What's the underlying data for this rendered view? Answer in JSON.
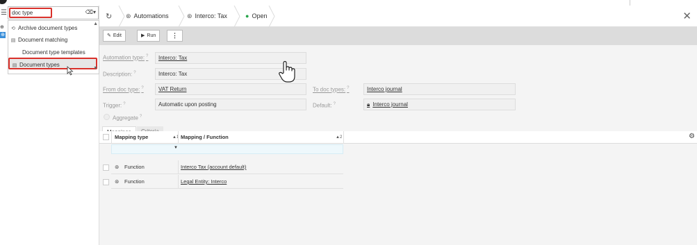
{
  "search": {
    "value": "doc type"
  },
  "dropdown": {
    "items": [
      {
        "label": "Archive document types",
        "icon": "history-icon"
      },
      {
        "label": "Document matching",
        "icon": "document-icon"
      },
      {
        "label": "Document type templates",
        "icon": ""
      },
      {
        "label": "Document types",
        "icon": "document-icon",
        "selected": true
      }
    ]
  },
  "breadcrumbs": [
    {
      "label": "Automations",
      "icon": "automation-icon"
    },
    {
      "label": "Interco: Tax",
      "icon": "automation-icon"
    },
    {
      "label": "Open",
      "icon": "status-dot"
    }
  ],
  "toolbar": {
    "edit_label": "Edit",
    "run_label": "Run"
  },
  "form": {
    "automation_type_label": "Automation type:",
    "automation_type_value": "Interco: Tax",
    "description_label": "Description:",
    "description_value": "Interco: Tax",
    "from_doc_type_label": "From doc type:",
    "from_doc_type_value": "VAT Return",
    "to_doc_types_label": "To doc types:",
    "to_doc_types_value": "Interco journal",
    "trigger_label": "Trigger:",
    "trigger_value": "Automatic upon posting",
    "default_label": "Default:",
    "default_value": "Interco journal",
    "aggregate_label": "Aggregate"
  },
  "tabs": [
    {
      "label": "Mappings",
      "active": true
    },
    {
      "label": "Criteria",
      "active": false
    }
  ],
  "grid": {
    "columns": [
      {
        "label": "Mapping type",
        "sort": "▲1"
      },
      {
        "label": "Mapping / Function",
        "sort": "▲2"
      }
    ],
    "rows": [
      {
        "type": "Function",
        "mapping": "Interco Tax (account default)"
      },
      {
        "type": "Function",
        "mapping": "Legal Entity: Interco"
      }
    ]
  },
  "colors": {
    "highlight_red": "#d9302a",
    "status_green": "#27a54a",
    "accent_blue": "#3a8fd9"
  }
}
